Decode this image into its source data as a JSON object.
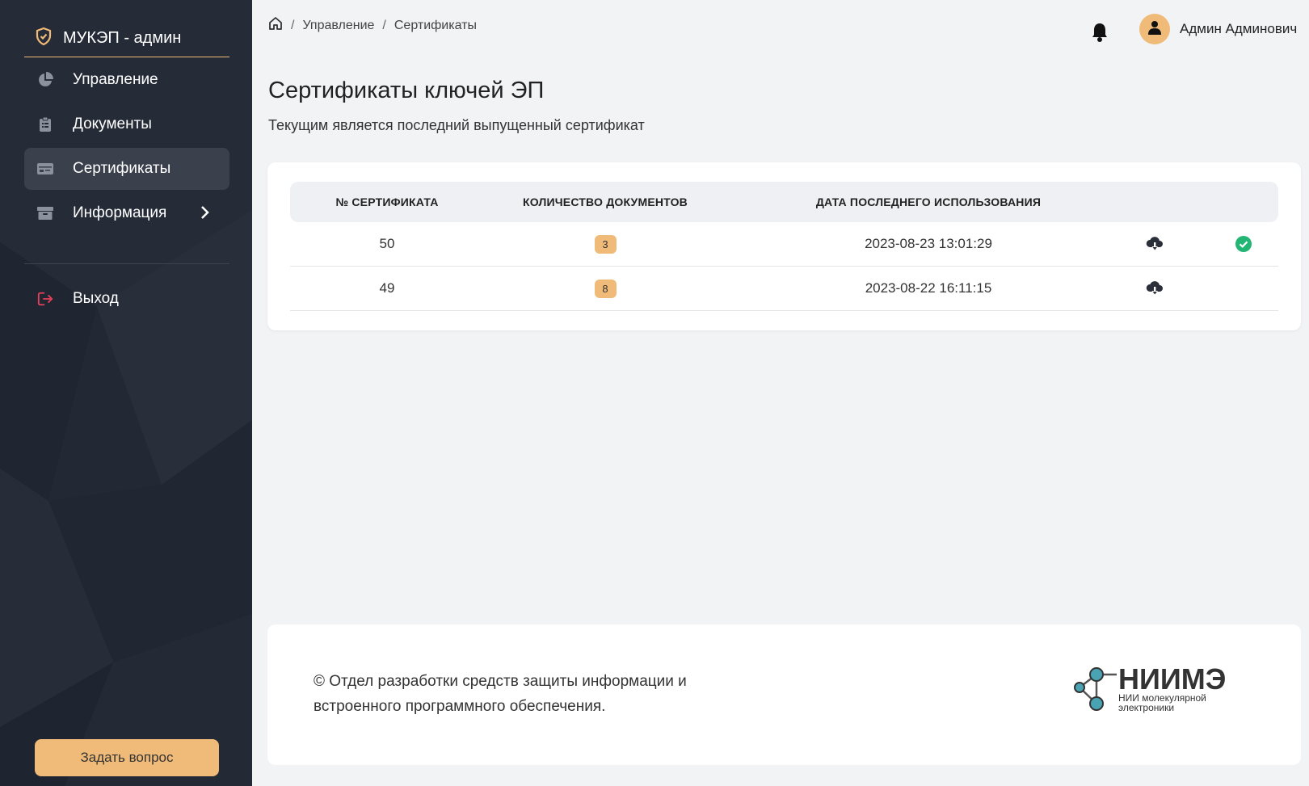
{
  "app": {
    "brand": "МУКЭП - админ"
  },
  "sidebar": {
    "items": [
      {
        "label": "Управление",
        "icon": "pie-chart-icon"
      },
      {
        "label": "Документы",
        "icon": "clipboard-icon"
      },
      {
        "label": "Сертификаты",
        "icon": "id-card-icon",
        "active": true
      },
      {
        "label": "Информация",
        "icon": "archive-icon",
        "has_children": true
      }
    ],
    "logout_label": "Выход",
    "ask_button": "Задать вопрос"
  },
  "breadcrumb": [
    "Управление",
    "Сертификаты"
  ],
  "user": {
    "name": "Админ Админович"
  },
  "page": {
    "title": "Сертификаты ключей ЭП",
    "subtitle": "Текущим является последний выпущенный сертификат"
  },
  "table": {
    "columns": [
      "№ СЕРТИФИКАТА",
      "КОЛИЧЕСТВО ДОКУМЕНТОВ",
      "ДАТА ПОСЛЕДНЕГО ИСПОЛЬЗОВАНИЯ"
    ],
    "rows": [
      {
        "number": "50",
        "docs": "3",
        "last_used": "2023-08-23 13:01:29",
        "current": true
      },
      {
        "number": "49",
        "docs": "8",
        "last_used": "2023-08-22 16:11:15",
        "current": false
      }
    ]
  },
  "footer": {
    "text": "© Отдел разработки средств защиты информации и встроенного программного обеспечения.",
    "logo_title": "НИИМЭ",
    "logo_sub1": "НИИ молекулярной",
    "logo_sub2": "электроники"
  },
  "colors": {
    "sidebar_bg": "#222935",
    "accent": "#f0bb78",
    "success": "#22b573",
    "logout": "#e8405a"
  }
}
